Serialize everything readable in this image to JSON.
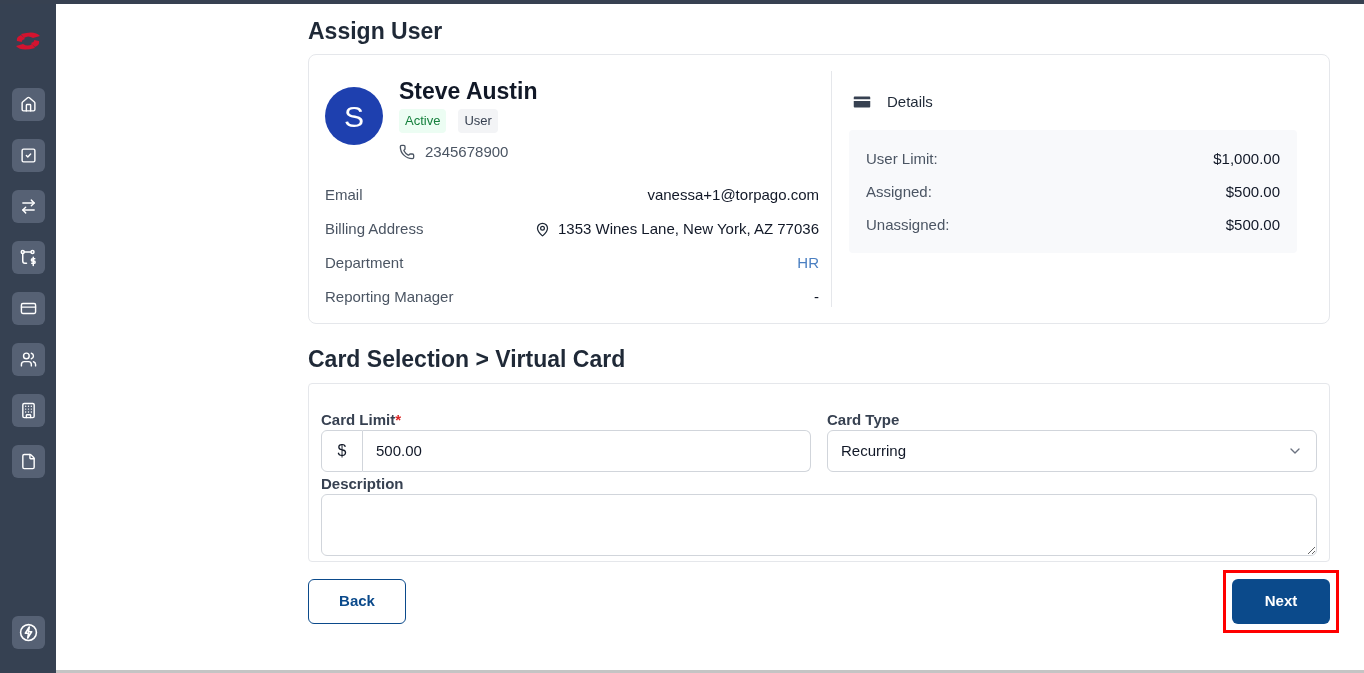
{
  "page_title": "Assign User",
  "user": {
    "initial": "S",
    "name": "Steve Austin",
    "badges": [
      {
        "label": "Active",
        "kind": "status"
      },
      {
        "label": "User",
        "kind": "role"
      }
    ],
    "phone": "2345678900",
    "fields": [
      {
        "label": "Email",
        "value": "vanessa+1@torpago.com",
        "kind": "text"
      },
      {
        "label": "Billing Address",
        "value": "1353 Wines Lane, New York, AZ 77036",
        "kind": "address"
      },
      {
        "label": "Department",
        "value": "HR",
        "kind": "link"
      },
      {
        "label": "Reporting Manager",
        "value": "-",
        "kind": "text"
      }
    ]
  },
  "details": {
    "title": "Details",
    "rows": [
      {
        "label": "User Limit:",
        "value": "$1,000.00"
      },
      {
        "label": "Assigned:",
        "value": "$500.00"
      },
      {
        "label": "Unassigned:",
        "value": "$500.00"
      }
    ]
  },
  "card_section": {
    "title": "Card Selection > Virtual Card",
    "card_limit": {
      "label": "Card Limit",
      "required_mark": "*",
      "prefix": "$",
      "value": "500.00"
    },
    "card_type": {
      "label": "Card Type",
      "value": "Recurring"
    },
    "description": {
      "label": "Description"
    }
  },
  "buttons": [
    {
      "label": "Back",
      "kind": "secondary",
      "highlighted": false
    },
    {
      "label": "Next",
      "kind": "primary",
      "highlighted": true
    }
  ]
}
